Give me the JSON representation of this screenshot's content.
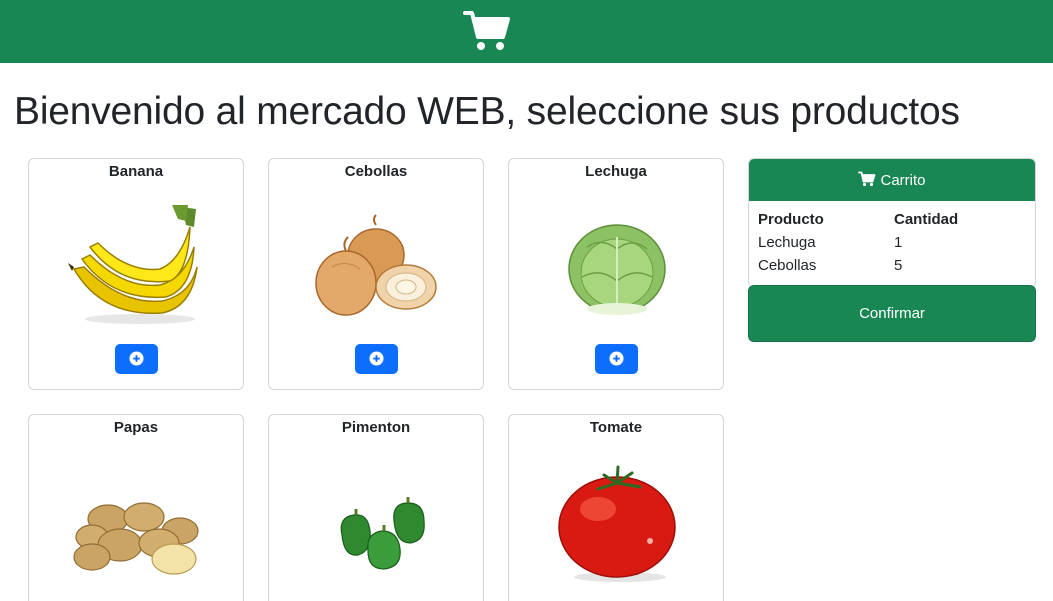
{
  "header": {
    "logo_icon": "shopping-cart-icon",
    "color": "#198754"
  },
  "page": {
    "title": "Bienvenido al mercado WEB, seleccione sus productos"
  },
  "products": [
    {
      "name": "Banana",
      "image": "banana-image",
      "add_icon": "plus-circle-icon"
    },
    {
      "name": "Cebollas",
      "image": "onions-image",
      "add_icon": "plus-circle-icon"
    },
    {
      "name": "Lechuga",
      "image": "lettuce-image",
      "add_icon": "plus-circle-icon"
    },
    {
      "name": "Papas",
      "image": "potatoes-image",
      "add_icon": "plus-circle-icon"
    },
    {
      "name": "Pimenton",
      "image": "peppers-image",
      "add_icon": "plus-circle-icon"
    },
    {
      "name": "Tomate",
      "image": "tomato-image",
      "add_icon": "plus-circle-icon"
    }
  ],
  "cart": {
    "title": "Carrito",
    "icon": "shopping-cart-icon",
    "columns": [
      "Producto",
      "Cantidad"
    ],
    "rows": [
      {
        "product": "Lechuga",
        "quantity": "1"
      },
      {
        "product": "Cebollas",
        "quantity": "5"
      }
    ],
    "confirm_label": "Confirmar"
  },
  "colors": {
    "primary_green": "#198754",
    "button_blue": "#0d6efd"
  }
}
